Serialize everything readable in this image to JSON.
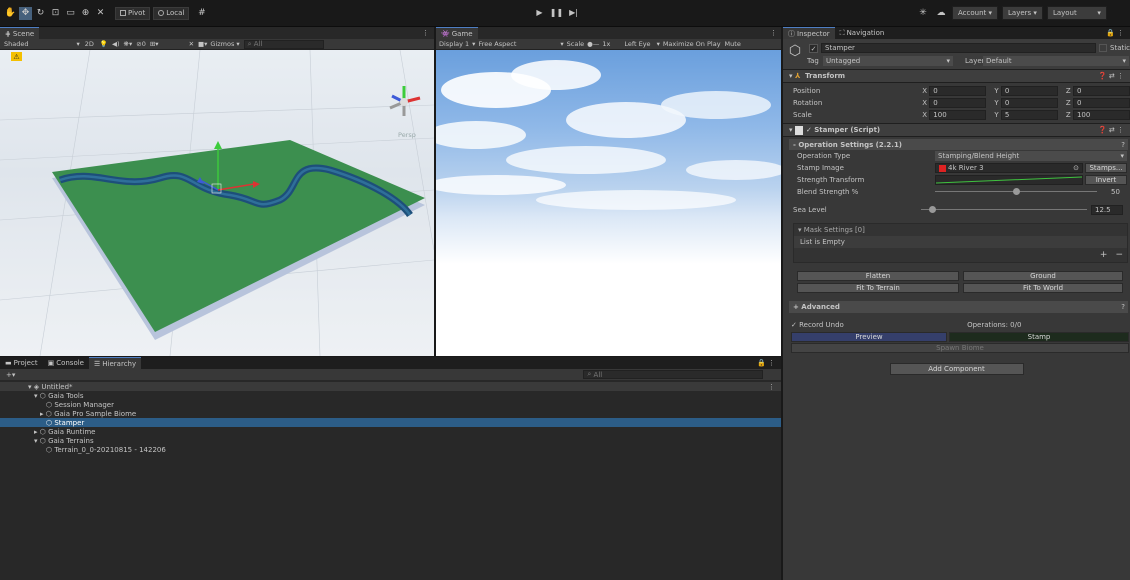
{
  "toolbar": {
    "pivot": "Pivot",
    "local": "Local",
    "account": "Account",
    "layers": "Layers",
    "layout": "Layout"
  },
  "scene": {
    "tab": "Scene",
    "shading": "Shaded",
    "mode2d": "2D",
    "gizmos": "Gizmos",
    "search": "All",
    "persp": "Persp"
  },
  "game": {
    "tab": "Game",
    "display": "Display 1",
    "aspect": "Free Aspect",
    "scale_label": "Scale",
    "scale_value": "1x",
    "eye": "Left Eye",
    "maximize": "Maximize On Play",
    "mute": "Mute"
  },
  "bottom": {
    "tabs": [
      "Project",
      "Console",
      "Hierarchy"
    ],
    "search": "All",
    "scene_name": "Untitled*",
    "items": [
      {
        "label": "Gaia Tools",
        "indent": 1
      },
      {
        "label": "Session Manager",
        "indent": 2
      },
      {
        "label": "Gaia Pro Sample Biome",
        "indent": 2
      },
      {
        "label": "Stamper",
        "indent": 2
      },
      {
        "label": "Gaia Runtime",
        "indent": 1
      },
      {
        "label": "Gaia Terrains",
        "indent": 1
      },
      {
        "label": "Terrain_0_0-20210815 - 142206",
        "indent": 2
      }
    ]
  },
  "inspector": {
    "tab_inspector": "Inspector",
    "tab_navigation": "Navigation",
    "object_name": "Stamper",
    "static": "Static",
    "tag_label": "Tag",
    "tag_value": "Untagged",
    "layer_label": "Layer",
    "layer_value": "Default",
    "transform": {
      "title": "Transform",
      "position_label": "Position",
      "rotation_label": "Rotation",
      "scale_label": "Scale",
      "position": [
        "0",
        "0",
        "0"
      ],
      "rotation": [
        "0",
        "0",
        "0"
      ],
      "scale": [
        "100",
        "5",
        "100"
      ]
    },
    "stamper": {
      "title": "Stamper (Script)",
      "op_settings": "- Operation Settings  (2.2.1)",
      "op_type_label": "Operation Type",
      "op_type_value": "Stamping/Blend Height",
      "stamp_image_label": "Stamp Image",
      "stamp_image_value": "4k River 3",
      "stamps_button": "Stamps...",
      "strength_label": "Strength Transform",
      "invert_button": "Invert",
      "blend_label": "Blend Strength %",
      "blend_value": "50",
      "blend_fraction": 0.5,
      "sea_label": "Sea Level",
      "sea_value": "12.5",
      "sea_fraction": 0.05,
      "mask_settings": "Mask Settings [0]",
      "list_empty": "List is Empty",
      "flatten": "Flatten",
      "ground": "Ground",
      "fit_terrain": "Fit To Terrain",
      "fit_world": "Fit To World",
      "advanced": "+ Advanced",
      "record_undo": "Record Undo",
      "operations": "Operations: 0/0",
      "preview": "Preview",
      "stamp": "Stamp",
      "spawn_biome": "Spawn Biome"
    },
    "add_component": "Add Component"
  },
  "colors": {
    "accent": "#4e7ec3",
    "selection": "#2c5d87",
    "preview_bg": "#353f6b",
    "stamp_bg": "#1d2b1d",
    "terrain": "#3c8f4f"
  }
}
